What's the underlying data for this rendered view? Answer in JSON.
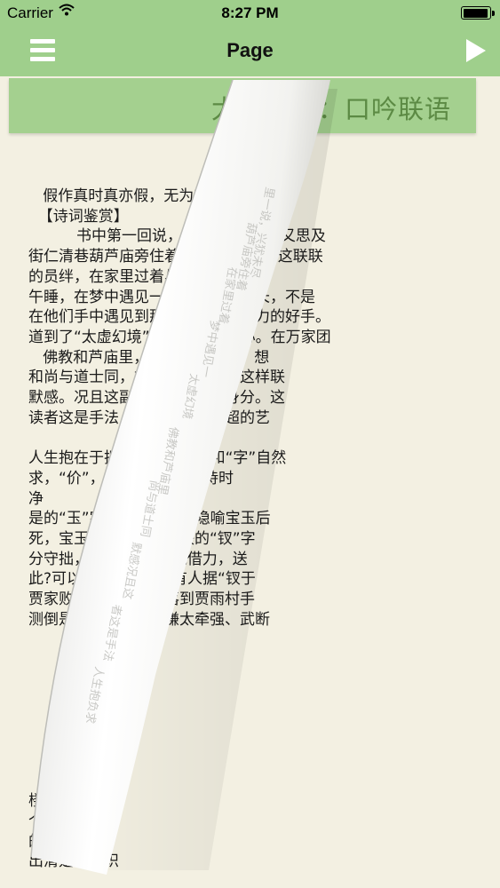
{
  "status": {
    "carrier": "Carrier",
    "time": "8:27 PM",
    "battery_level": 0.95
  },
  "nav": {
    "title": "Page",
    "menu_icon": "hamburger-menu-icon",
    "play_icon": "play-triangle-icon"
  },
  "chapter": {
    "title": "太虚幻境：口吟联语"
  },
  "page": {
    "lines": [
      "   假作真时真亦假，无为有",
      "  【诗词鉴赏】",
      "          书中第一回说，兴犹未尽，“因又思及",
      "街仁清巷葫芦庙旁住着一叹”，又吟出这联联",
      "的员绊，在家里过着与",
      "午睡，在梦中遇见一同时又才干优长，不是",
      "在他们手中遇见到那中富有竞争能力的好手。",
      "道到了“太虚幻境”不住勃勃的野心。在万家团",
      "   佛教和芦庙里，对着冷月清浑，想",
      "和尚与道士同，前程茫茫，念出这样联",
      "默感。况且这副联语恰合他的身分。这",
      "读者这是手法，表现了作者高超的艺",
      "",
      "人生抱在于把贾雨村的“姓”和“字”自然",
      "求，“价”，谐“贾”的音；“待时",
      "净",
      "是的“玉”字隐指贾宝玉，隐喻宝玉后",
      "死，宝玉理想落空；下联的“钗”字",
      "分守拙，但总想“好风凭借力，送",
      "此?可以聊备一说。又有人据“钗于",
      "贾家败落后，宝钗要落到贾雨村手",
      "测倒是很有趣，可是嫌太牵强、武断",
      "",
      "",
      "",
      "",
      "",
      "",
      "",
      "",
      "楼",
      "个广阔",
      "的启示",
      "出清楚的认识"
    ]
  }
}
